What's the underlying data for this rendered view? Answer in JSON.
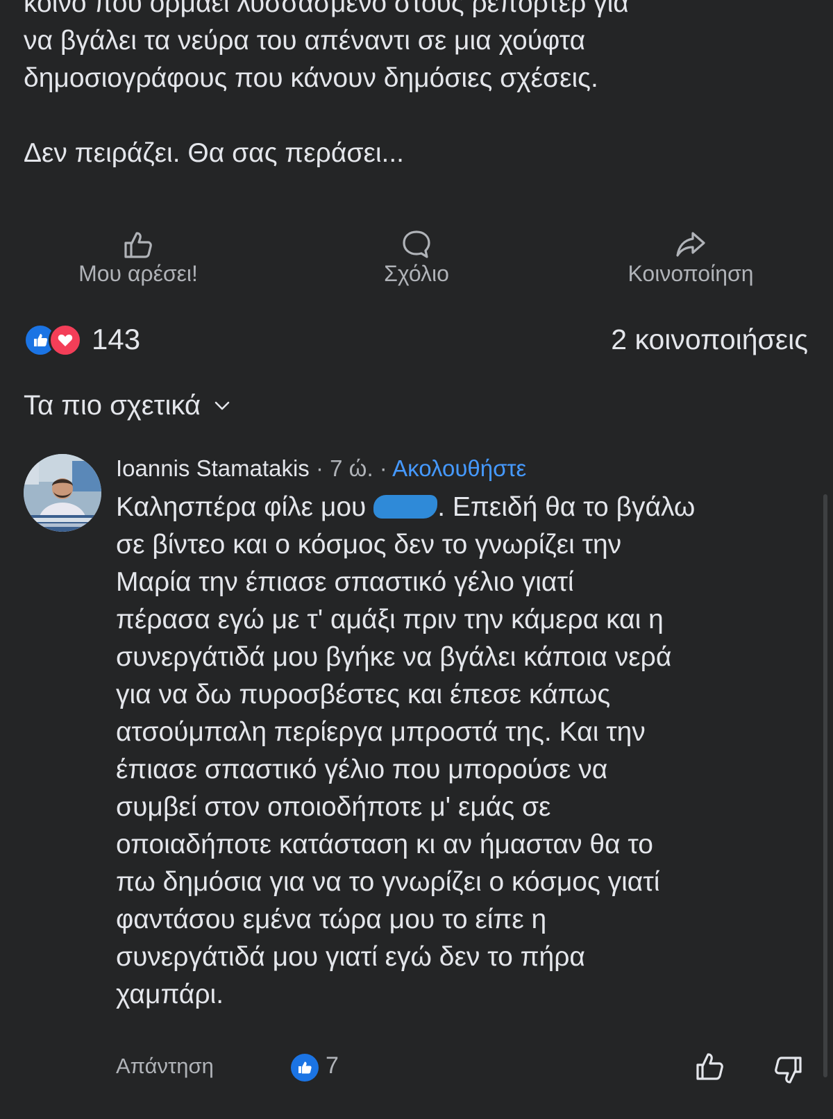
{
  "post": {
    "text_lines": [
      "κοινό που ορμάει λυσσασμένο στους ρεπόρτερ για",
      "να βγάλει τα νεύρα του απέναντι σε μια χούφτα",
      "δημοσιογράφους που κάνουν δημόσιες σχέσεις.",
      "",
      "Δεν πειράζει. Θα σας περάσει..."
    ],
    "actions": {
      "like_label": "Μου αρέσει!",
      "comment_label": "Σχόλιο",
      "share_label": "Κοινοποίηση"
    },
    "reactions": {
      "count": "143",
      "types": [
        "like",
        "love"
      ]
    },
    "shares": "2 κοινοποιήσεις"
  },
  "sort": {
    "label": "Τα πιο σχετικά"
  },
  "comment": {
    "author": "Ioannis Stamatakis",
    "separator": "·",
    "time": "7 ώ.",
    "follow_label": "Ακολουθήστε",
    "lines": {
      "l0_before": "Καλησπέρα φίλε μου ",
      "l0_after": ". Επειδή θα το βγάλω",
      "l1": "σε βίντεο και ο κόσμος δεν το γνωρίζει την",
      "l2": "Μαρία την έπιασε σπαστικό γέλιο γιατί",
      "l3": "πέρασα εγώ με τ' αμάξι πριν την κάμερα και η",
      "l4": "συνεργάτιδά μου βγήκε να βγάλει κάποια νερά",
      "l5": "για να δω πυροσβέστες και έπεσε κάπως",
      "l6": "ατσούμπαλη περίεργα μπροστά της. Και την",
      "l7": "έπιασε σπαστικό γέλιο που μπορούσε να",
      "l8": "συμβεί στον οποιοδήποτε μ' εμάς σε",
      "l9": "οποιαδήποτε κατάσταση κι αν ήμασταν θα το",
      "l10": "πω δημόσια για να το γνωρίζει ο κόσμος γιατί",
      "l11": "φαντάσου εμένα τώρα μου το είπε η",
      "l12": "συνεργάτιδά μου γιατί εγώ δεν το πήρα",
      "l13": "χαμπάρι."
    },
    "reply_label": "Απάντηση",
    "like_count": "7"
  },
  "colors": {
    "background": "#242526",
    "primary_text": "#e4e6eb",
    "secondary_text": "#b0b3b8",
    "accent_blue": "#4599ff",
    "like_blue": "#1b74e4",
    "love_red": "#f33e58"
  },
  "icons": {
    "like_action": "thumbs-up-outline-icon",
    "comment_action": "speech-bubble-icon",
    "share_action": "share-arrow-icon",
    "sort_chevron": "chevron-down-icon",
    "upvote": "thumbs-up-outline-icon",
    "downvote": "thumbs-down-outline-icon"
  }
}
